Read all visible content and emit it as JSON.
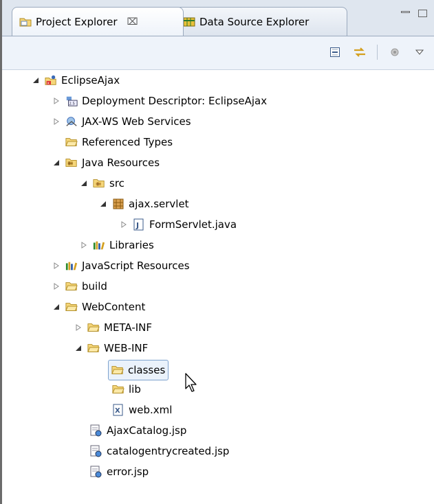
{
  "tabs": [
    {
      "label": "Project Explorer",
      "close": "⌧",
      "active": true
    },
    {
      "label": "Data Source Explorer",
      "active": false
    }
  ],
  "tree": [
    {
      "label": "EclipseAjax",
      "icon": "project-icon",
      "expanded": true
    },
    {
      "label": "Deployment Descriptor: EclipseAjax",
      "icon": "deployment-descriptor-icon",
      "expanded": false
    },
    {
      "label": "JAX-WS Web Services",
      "icon": "web-services-icon",
      "expanded": false
    },
    {
      "label": "Referenced Types",
      "icon": "folder-icon",
      "expanded": null
    },
    {
      "label": "Java Resources",
      "icon": "java-resources-icon",
      "expanded": true
    },
    {
      "label": "src",
      "icon": "source-folder-icon",
      "expanded": true
    },
    {
      "label": "ajax.servlet",
      "icon": "package-icon",
      "expanded": true
    },
    {
      "label": "FormServlet.java",
      "icon": "java-file-icon",
      "expanded": false
    },
    {
      "label": "Libraries",
      "icon": "libraries-icon",
      "expanded": false
    },
    {
      "label": "JavaScript Resources",
      "icon": "libraries-icon",
      "expanded": false
    },
    {
      "label": "build",
      "icon": "folder-icon",
      "expanded": false
    },
    {
      "label": "WebContent",
      "icon": "folder-icon",
      "expanded": true
    },
    {
      "label": "META-INF",
      "icon": "folder-icon",
      "expanded": false
    },
    {
      "label": "WEB-INF",
      "icon": "folder-icon",
      "expanded": true
    },
    {
      "label": "classes",
      "icon": "folder-icon",
      "expanded": null,
      "selected": true
    },
    {
      "label": "lib",
      "icon": "folder-icon",
      "expanded": null
    },
    {
      "label": "web.xml",
      "icon": "xml-file-icon",
      "expanded": null
    },
    {
      "label": "AjaxCatalog.jsp",
      "icon": "jsp-file-icon",
      "expanded": null
    },
    {
      "label": "catalogentrycreated.jsp",
      "icon": "jsp-file-icon",
      "expanded": null
    },
    {
      "label": "error.jsp",
      "icon": "jsp-file-icon",
      "expanded": null
    }
  ]
}
